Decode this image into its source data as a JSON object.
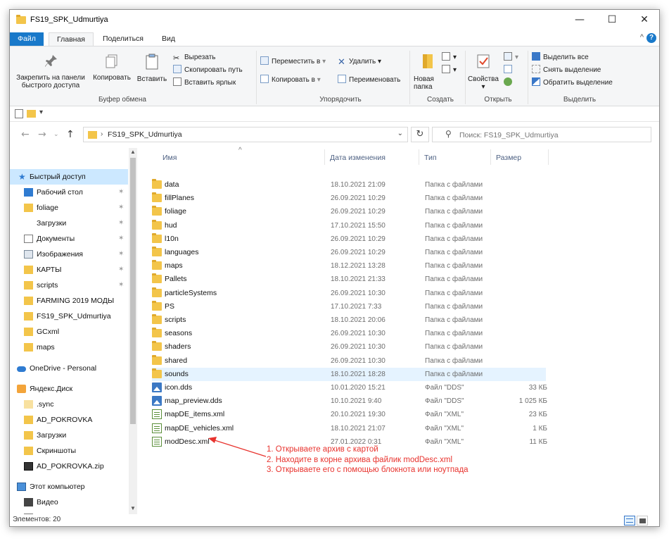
{
  "window": {
    "title": "FS19_SPK_Udmurtiya"
  },
  "titlebar": {
    "minimize": "—",
    "maximize": "☐",
    "close": "✕"
  },
  "tabs": [
    {
      "label": "Файл"
    },
    {
      "label": "Главная"
    },
    {
      "label": "Поделиться"
    },
    {
      "label": "Вид"
    }
  ],
  "ribbon": {
    "clipboard": {
      "pin_label_1": "Закрепить на панели",
      "pin_label_2": "быстрого доступа",
      "copy_label": "Копировать",
      "paste_label": "Вставить",
      "cut_label": "Вырезать",
      "copy_path_label": "Скопировать путь",
      "paste_shortcut_label": "Вставить ярлык",
      "group_label": "Буфер обмена"
    },
    "organize": {
      "move_to_label": "Переместить в",
      "copy_to_label": "Копировать в",
      "delete_label": "Удалить",
      "rename_label": "Переименовать",
      "group_label": "Упорядочить"
    },
    "create": {
      "new_folder_1": "Новая",
      "new_folder_2": "папка",
      "group_label": "Создать"
    },
    "open": {
      "properties_label": "Свойства",
      "group_label": "Открыть"
    },
    "select": {
      "select_all": "Выделить все",
      "select_none": "Снять выделение",
      "invert": "Обратить выделение",
      "group_label": "Выделить"
    }
  },
  "address": {
    "path": "FS19_SPK_Udmurtiya",
    "search_placeholder": "Поиск: FS19_SPK_Udmurtiya"
  },
  "nav": {
    "quick_access": "Быстрый доступ",
    "items": [
      {
        "label": "Рабочий стол",
        "pinned": "✶"
      },
      {
        "label": "foliage",
        "pinned": "✶"
      },
      {
        "label": "Загрузки",
        "pinned": "✶"
      },
      {
        "label": "Документы",
        "pinned": "✶"
      },
      {
        "label": "Изображения",
        "pinned": "✶"
      },
      {
        "label": "КАРТЫ",
        "pinned": "✶"
      },
      {
        "label": "scripts",
        "pinned": "✶"
      },
      {
        "label": "FARMING 2019 МОДЫ"
      },
      {
        "label": "FS19_SPK_Udmurtiya"
      },
      {
        "label": "GCxml"
      },
      {
        "label": "maps"
      }
    ],
    "onedrive": "OneDrive - Personal",
    "yandex": "Яндекс.Диск",
    "yandex_items": [
      {
        "label": ".sync"
      },
      {
        "label": "AD_POKROVKA"
      },
      {
        "label": "Загрузки"
      },
      {
        "label": "Скриншоты"
      },
      {
        "label": "AD_POKROVKA.zip"
      }
    ],
    "this_pc": "Этот компьютер",
    "pc_items": [
      {
        "label": "Видео"
      },
      {
        "label": "Документы"
      }
    ]
  },
  "columns": {
    "name": "Имя",
    "date": "Дата изменения",
    "type": "Тип",
    "size": "Размер"
  },
  "files": [
    {
      "name": "data",
      "date": "18.10.2021 21:09",
      "type": "Папка с файлами",
      "size": "",
      "kind": "folder"
    },
    {
      "name": "fillPlanes",
      "date": "26.09.2021 10:29",
      "type": "Папка с файлами",
      "size": "",
      "kind": "folder"
    },
    {
      "name": "foliage",
      "date": "26.09.2021 10:29",
      "type": "Папка с файлами",
      "size": "",
      "kind": "folder"
    },
    {
      "name": "hud",
      "date": "17.10.2021 15:50",
      "type": "Папка с файлами",
      "size": "",
      "kind": "folder"
    },
    {
      "name": "l10n",
      "date": "26.09.2021 10:29",
      "type": "Папка с файлами",
      "size": "",
      "kind": "folder"
    },
    {
      "name": "languages",
      "date": "26.09.2021 10:29",
      "type": "Папка с файлами",
      "size": "",
      "kind": "folder"
    },
    {
      "name": "maps",
      "date": "18.12.2021 13:28",
      "type": "Папка с файлами",
      "size": "",
      "kind": "folder"
    },
    {
      "name": "Pallets",
      "date": "18.10.2021 21:33",
      "type": "Папка с файлами",
      "size": "",
      "kind": "folder"
    },
    {
      "name": "particleSystems",
      "date": "26.09.2021 10:30",
      "type": "Папка с файлами",
      "size": "",
      "kind": "folder"
    },
    {
      "name": "PS",
      "date": "17.10.2021 7:33",
      "type": "Папка с файлами",
      "size": "",
      "kind": "folder"
    },
    {
      "name": "scripts",
      "date": "18.10.2021 20:06",
      "type": "Папка с файлами",
      "size": "",
      "kind": "folder"
    },
    {
      "name": "seasons",
      "date": "26.09.2021 10:30",
      "type": "Папка с файлами",
      "size": "",
      "kind": "folder"
    },
    {
      "name": "shaders",
      "date": "26.09.2021 10:30",
      "type": "Папка с файлами",
      "size": "",
      "kind": "folder"
    },
    {
      "name": "shared",
      "date": "26.09.2021 10:30",
      "type": "Папка с файлами",
      "size": "",
      "kind": "folder"
    },
    {
      "name": "sounds",
      "date": "18.10.2021 18:28",
      "type": "Папка с файлами",
      "size": "",
      "kind": "folder",
      "selected": true
    },
    {
      "name": "icon.dds",
      "date": "10.01.2020 15:21",
      "type": "Файл \"DDS\"",
      "size": "33 КБ",
      "kind": "dds"
    },
    {
      "name": "map_preview.dds",
      "date": "10.10.2021 9:40",
      "type": "Файл \"DDS\"",
      "size": "1 025 КБ",
      "kind": "dds"
    },
    {
      "name": "mapDE_items.xml",
      "date": "20.10.2021 19:30",
      "type": "Файл \"XML\"",
      "size": "23 КБ",
      "kind": "xml"
    },
    {
      "name": "mapDE_vehicles.xml",
      "date": "18.10.2021 21:07",
      "type": "Файл \"XML\"",
      "size": "1 КБ",
      "kind": "xml"
    },
    {
      "name": "modDesc.xml",
      "date": "27.01.2022 0:31",
      "type": "Файл \"XML\"",
      "size": "11 КБ",
      "kind": "xml"
    }
  ],
  "annotation": {
    "line1": "1. Открываете архив с картой",
    "line2": "2. Находите в корне архива файлик modDesc.xml",
    "line3": "3. Открываете его с помощью блокнота или ноутпада"
  },
  "status": {
    "count": "Элементов: 20"
  },
  "colors": {
    "accent": "#1979ca",
    "annotation": "#e8332e",
    "selection": "#cce8ff",
    "folder": "#f3c54a"
  }
}
